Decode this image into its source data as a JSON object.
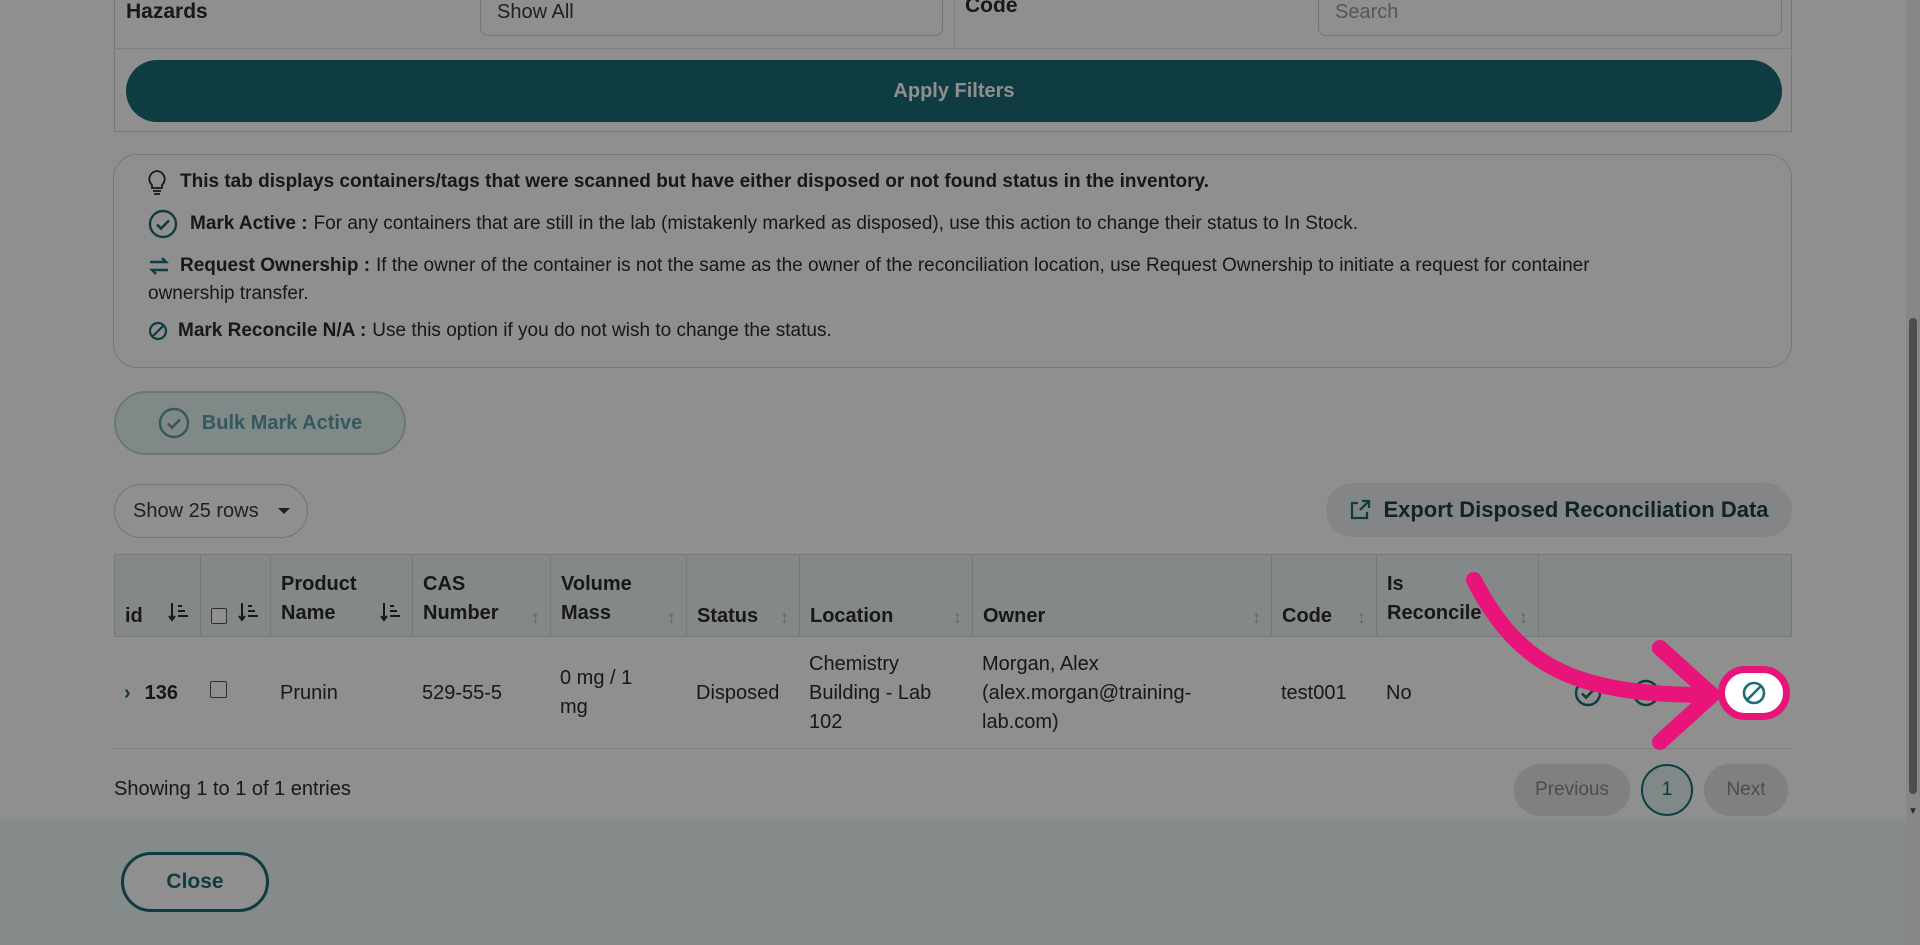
{
  "filters": {
    "hazards_label": "Hazards",
    "hazards_value": "Show All",
    "code_label": "Code",
    "code_placeholder": "Search",
    "apply_label": "Apply Filters"
  },
  "info": {
    "intro": "This tab displays containers/tags that were scanned but have either disposed or not found status in the inventory.",
    "mark_active_title": "Mark Active :",
    "mark_active_text": "For any containers that are still in the lab (mistakenly marked as disposed), use this action to change their status to In Stock.",
    "request_title": "Request Ownership :",
    "request_text": "If the owner of the container is not the same as the owner of the reconciliation location, use Request Ownership to initiate a request for container",
    "request_text_2": "ownership transfer.",
    "na_title": "Mark Reconcile N/A :",
    "na_text": "Use this option if you do not wish to change the status."
  },
  "bulk_label": "Bulk Mark Active",
  "rows_select": "Show 25 rows",
  "export_label": "Export Disposed Reconciliation Data",
  "table": {
    "headers": {
      "id": "id",
      "product_1": "Product",
      "product_2": "Name",
      "cas_1": "CAS",
      "cas_2": "Number",
      "vol_1": "Volume",
      "vol_2": "Mass",
      "status": "Status",
      "location": "Location",
      "owner": "Owner",
      "code": "Code",
      "recon_1": "Is",
      "recon_2": "Reconcile"
    },
    "row": {
      "id": "136",
      "product": "Prunin",
      "cas": "529-55-5",
      "vol_1": "0 mg / 1",
      "vol_2": "mg",
      "status": "Disposed",
      "loc_1": "Chemistry",
      "loc_2": "Building - Lab",
      "loc_3": "102",
      "owner_1": "Morgan, Alex",
      "owner_2": "(alex.morgan@training-",
      "owner_3": "lab.com)",
      "code": "test001",
      "reconciled": "No"
    }
  },
  "pagination": {
    "showing": "Showing 1 to 1 of 1 entries",
    "prev": "Previous",
    "page": "1",
    "next": "Next"
  },
  "close_label": "Close",
  "colors": {
    "primary": "#1c6b75",
    "highlight": "#e8147a"
  }
}
